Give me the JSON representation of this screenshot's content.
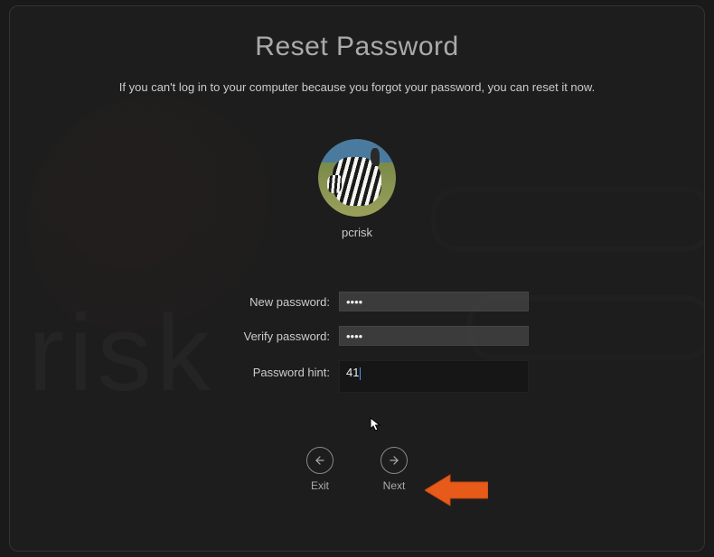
{
  "title": "Reset Password",
  "subtitle": "If you can't log in to your computer because you forgot your password, you can reset it now.",
  "user": {
    "name": "pcrisk"
  },
  "form": {
    "new_password_label": "New password:",
    "new_password_value": "••••",
    "verify_password_label": "Verify password:",
    "verify_password_value": "••••",
    "hint_label": "Password hint:",
    "hint_value": "41"
  },
  "nav": {
    "exit_label": "Exit",
    "next_label": "Next"
  },
  "callout": {
    "color": "#e85a1a"
  }
}
